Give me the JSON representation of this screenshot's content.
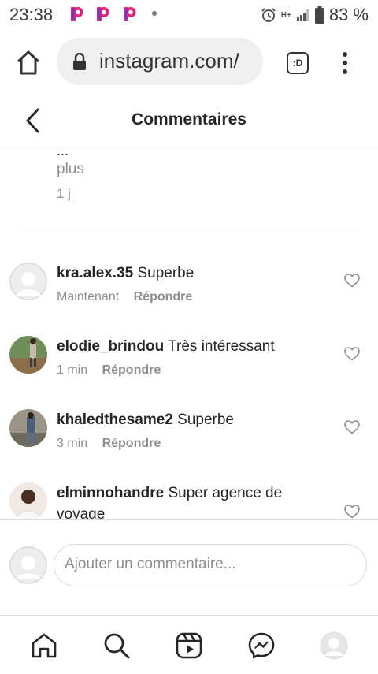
{
  "status_bar": {
    "time": "23:38",
    "network": "H+",
    "battery": "83 %",
    "app_icons": [
      "p-app-icon",
      "p-app-icon",
      "p-app-icon"
    ]
  },
  "browser": {
    "url": "instagram.com/",
    "tab_label": ":D"
  },
  "header": {
    "title": "Commentaires"
  },
  "caption": {
    "ellipsis": "...",
    "more": "plus",
    "time": "1 j"
  },
  "comments": [
    {
      "username": "kra.alex.35",
      "text": "Superbe",
      "time": "Maintenant",
      "reply": "Répondre",
      "avatar": "default"
    },
    {
      "username": "elodie_brindou",
      "text": "Très intéressant",
      "time": "1 min",
      "reply": "Répondre",
      "avatar": "photo"
    },
    {
      "username": "khaledthesame2",
      "text": "Superbe",
      "time": "3 min",
      "reply": "Répondre",
      "avatar": "photo"
    },
    {
      "username": "elminnohandre",
      "text": "Super agence de voyage",
      "time": "",
      "reply": "",
      "avatar": "photo"
    }
  ],
  "comment_input": {
    "placeholder": "Ajouter un commentaire..."
  },
  "nav": {
    "items": [
      "home-icon",
      "search-icon",
      "reels-icon",
      "messenger-icon",
      "profile-avatar"
    ]
  },
  "colors": {
    "text_primary": "#262626",
    "text_secondary": "#8e8e8e",
    "divider": "#dbdbdb",
    "status_p_icon": "#e3227a"
  }
}
